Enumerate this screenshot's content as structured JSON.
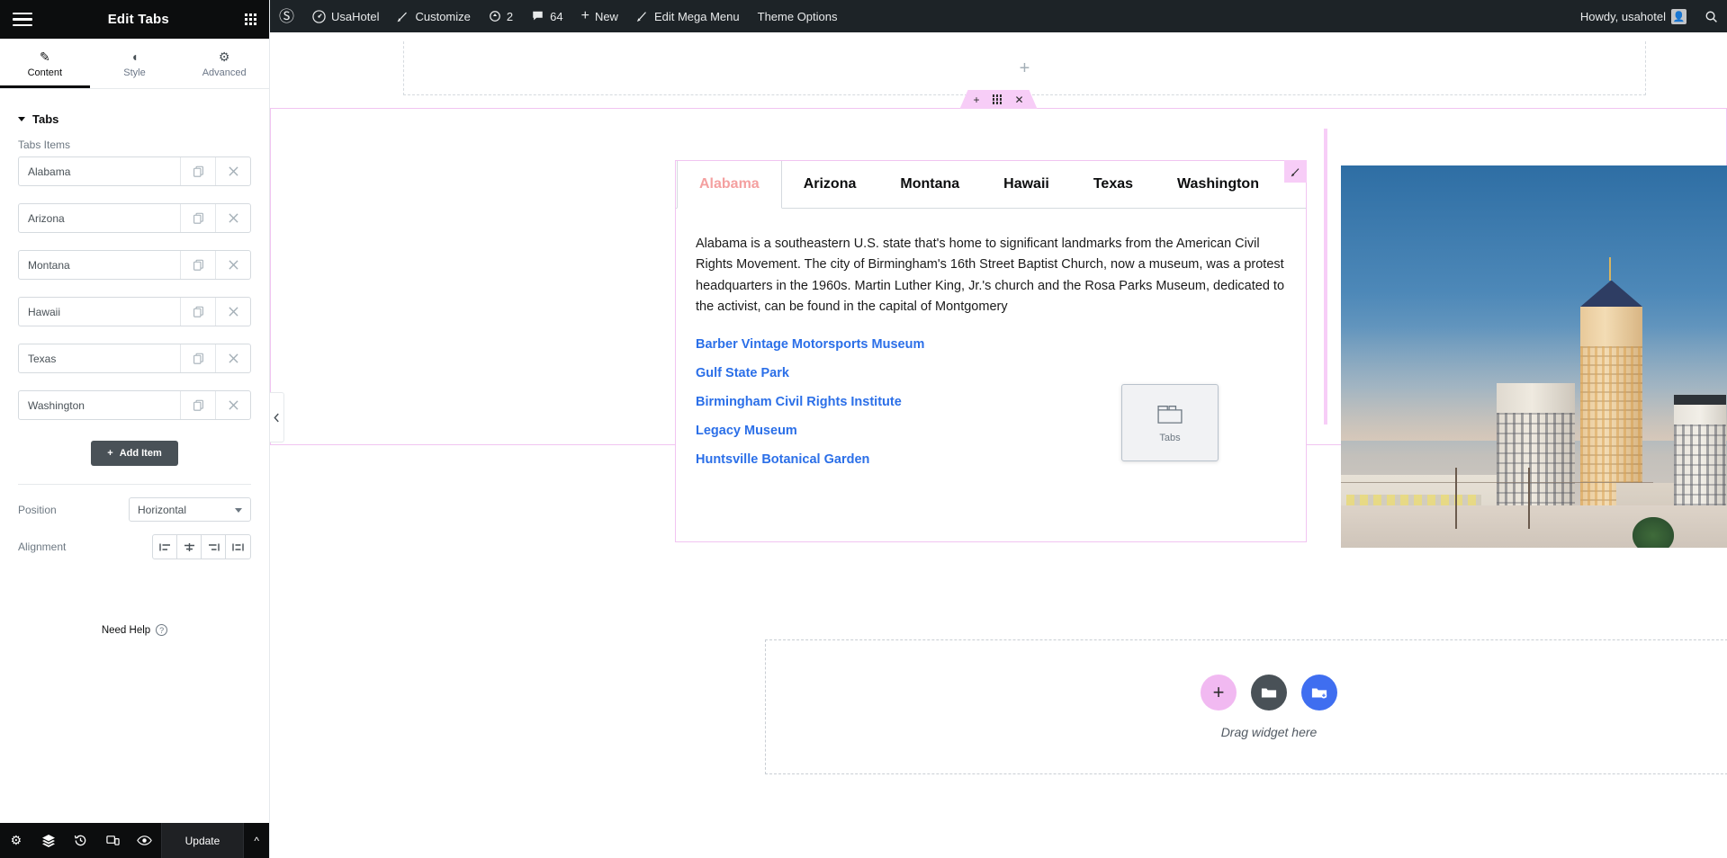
{
  "panel": {
    "title": "Edit Tabs",
    "menu_icon": "hamburger-icon",
    "widgets_icon": "widgets-grid-icon",
    "tabs": [
      {
        "label": "Content",
        "icon": "pencil-icon",
        "active": true
      },
      {
        "label": "Style",
        "icon": "half-circle-icon",
        "active": false
      },
      {
        "label": "Advanced",
        "icon": "gear-icon",
        "active": false
      }
    ],
    "section_title": "Tabs",
    "items_label": "Tabs Items",
    "items": [
      {
        "title": "Alabama"
      },
      {
        "title": "Arizona"
      },
      {
        "title": "Montana"
      },
      {
        "title": "Hawaii"
      },
      {
        "title": "Texas"
      },
      {
        "title": "Washington"
      }
    ],
    "duplicate_icon": "duplicate-icon",
    "remove_icon": "close-icon",
    "add_item_label": "Add Item",
    "position": {
      "label": "Position",
      "value": "Horizontal"
    },
    "alignment": {
      "label": "Alignment",
      "options": [
        "align-left",
        "align-center",
        "align-right",
        "align-justify"
      ]
    },
    "need_help": "Need Help",
    "footer": {
      "settings_icon": "gear-icon",
      "navigator_icon": "layers-icon",
      "history_icon": "history-icon",
      "responsive_icon": "responsive-icon",
      "preview_icon": "eye-icon",
      "update_label": "Update",
      "collapse_icon": "chevron-up-icon"
    }
  },
  "adminbar": {
    "logo": "wordpress-logo",
    "site_name": "UsaHotel",
    "customize": "Customize",
    "revisions_count": "2",
    "comments_count": "64",
    "new": "New",
    "edit_mega_menu": "Edit Mega Menu",
    "theme_options": "Theme Options",
    "howdy": "Howdy, usahotel",
    "search_icon": "search-icon"
  },
  "canvas": {
    "collapse_icon": "chevron-left-icon",
    "add_section_icon": "plus-icon",
    "section_handle": {
      "add_icon": "plus-icon",
      "drag_icon": "drag-dots-icon",
      "close_icon": "close-icon"
    },
    "widget": {
      "edit_icon": "pencil-icon",
      "tabs": [
        {
          "label": "Alabama",
          "active": true
        },
        {
          "label": "Arizona",
          "active": false
        },
        {
          "label": "Montana",
          "active": false
        },
        {
          "label": "Hawaii",
          "active": false
        },
        {
          "label": "Texas",
          "active": false
        },
        {
          "label": "Washington",
          "active": false
        }
      ],
      "paragraph": "Alabama is a southeastern U.S. state that's home to significant landmarks from the American Civil Rights Movement. The city of Birmingham's 16th Street Baptist Church, now a museum, was a protest headquarters in the 1960s. Martin Luther King, Jr.'s church and the Rosa Parks Museum, dedicated to the activist, can be found in the capital of Montgomery",
      "links": [
        "Barber Vintage Motorsports Museum",
        "Gulf State Park",
        "Birmingham Civil Rights Institute",
        "Legacy Museum",
        "Huntsville Botanical Garden"
      ],
      "link_color": "#2b6fe8",
      "active_tab_color": "#f4a0a0"
    },
    "drag_ghost": {
      "label": "Tabs",
      "icon": "tabs-icon"
    },
    "image": {
      "alt": "Montgomery Alabama downtown skyline at dusk"
    },
    "drop_area": {
      "text": "Drag widget here",
      "buttons": [
        "add-widget-icon",
        "folder-icon",
        "add-template-icon"
      ]
    }
  },
  "colors": {
    "section_pink": "#f7cdf7",
    "panel_dark": "#0c0d0e",
    "adminbar_dark": "#1d2327",
    "accent_blue": "#3f6ef0"
  }
}
